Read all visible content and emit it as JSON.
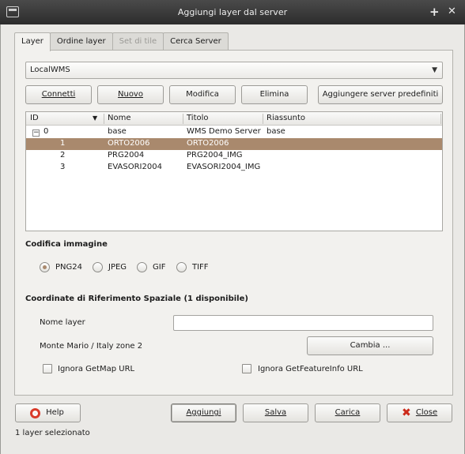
{
  "window": {
    "title": "Aggiungi layer dal server",
    "minimize_glyph": "+",
    "close_glyph": "✕"
  },
  "tabs": [
    {
      "label": "Layer",
      "state": "active"
    },
    {
      "label": "Ordine layer",
      "state": "normal"
    },
    {
      "label": "Set di tile",
      "state": "disabled"
    },
    {
      "label": "Cerca Server",
      "state": "normal"
    }
  ],
  "server_select": {
    "value": "LocalWMS"
  },
  "server_buttons": {
    "connect": "Connetti",
    "new": "Nuovo",
    "edit": "Modifica",
    "delete": "Elimina",
    "add_default": "Aggiungere server predefiniti"
  },
  "layer_tree": {
    "columns": [
      "ID",
      "Nome",
      "Titolo",
      "Riassunto"
    ],
    "rows": [
      {
        "expander": "−",
        "id": "0",
        "name": "base",
        "title": "WMS Demo Server",
        "abstract": "base"
      },
      {
        "id": "1",
        "name": "ORTO2006",
        "title": "ORTO2006",
        "abstract": "",
        "selected": true
      },
      {
        "id": "2",
        "name": "PRG2004",
        "title": "PRG2004_IMG",
        "abstract": ""
      },
      {
        "id": "3",
        "name": "EVASORI2004",
        "title": "EVASORI2004_IMG",
        "abstract": ""
      }
    ]
  },
  "image_encoding": {
    "heading": "Codifica immagine",
    "options": [
      "PNG24",
      "JPEG",
      "GIF",
      "TIFF"
    ],
    "selected": "PNG24"
  },
  "crs": {
    "heading": "Coordinate di Riferimento Spaziale (1 disponibile)",
    "layer_name_label": "Nome layer",
    "layer_name_value": "",
    "current_crs": "Monte Mario / Italy zone 2",
    "change_button": "Cambia ..."
  },
  "options": {
    "ignore_getmap": "Ignora GetMap URL",
    "ignore_getfeatureinfo": "Ignora GetFeatureInfo URL"
  },
  "footer": {
    "help": "Help",
    "add": "Aggiungi",
    "save": "Salva",
    "load": "Carica",
    "close": "Close"
  },
  "status": "1 layer selezionato",
  "colors": {
    "selection": "#a9896d",
    "titlebar": "#3a3a3a",
    "close_icon": "#cc2a1a"
  }
}
